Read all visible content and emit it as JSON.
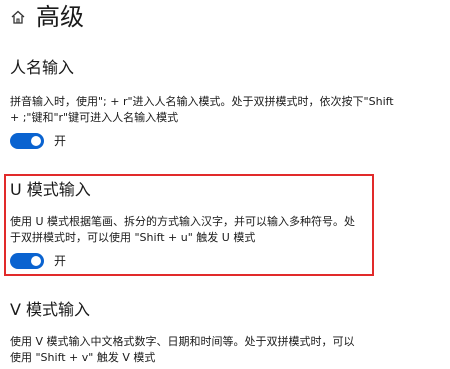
{
  "header": {
    "icon": "home-icon",
    "title": "高级"
  },
  "sections": [
    {
      "title": "人名输入",
      "description": "拼音输入时，使用\"; + r\"进入人名输入模式。处于双拼模式时，依次按下\"Shift + ;\"键和\"r\"键可进入人名输入模式",
      "toggle_state": "开",
      "toggle_on": true
    },
    {
      "title": "U 模式输入",
      "description": "使用 U 模式根据笔画、拆分的方式输入汉字，并可以输入多种符号。处于双拼模式时，可以使用 \"Shift + u\" 触发 U 模式",
      "toggle_state": "开",
      "toggle_on": true
    },
    {
      "title": "V 模式输入",
      "description": "使用 V 模式输入中文格式数字、日期和时间等。处于双拼模式时，可以使用 \"Shift + v\" 触发 V 模式"
    }
  ],
  "colors": {
    "accent": "#0a63d0",
    "highlight": "#e12a2a"
  }
}
